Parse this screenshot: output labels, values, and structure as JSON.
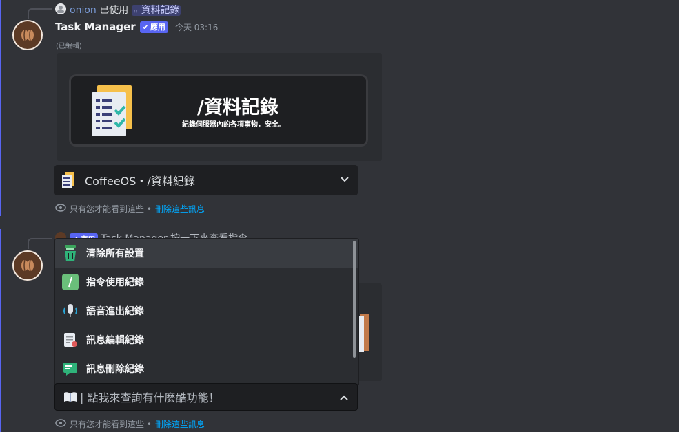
{
  "colors": {
    "background": "#313338",
    "accent": "#5865f2",
    "link": "#00a8fc",
    "dropdown_bg": "#1e1f22"
  },
  "message1": {
    "reply": {
      "user": "onion",
      "used_text": "已使用",
      "command": "資料記錄"
    },
    "author": "Task Manager",
    "app_tag": "應用",
    "timestamp": "今天 03:16",
    "edited": "(已編輯)",
    "banner": {
      "title": "/資料記錄",
      "subtitle": "紀錄伺服器內的各項事物，安全。"
    },
    "select": {
      "value": "CoffeeOS・/資料紀錄",
      "icon": "clipboard-icon"
    },
    "ephemeral": {
      "text": "只有您才能看到這些 •",
      "dismiss": "刪除這些訊息"
    }
  },
  "message2": {
    "reply": {
      "app_tag": "應用",
      "text": "Task Manager 按一下來查看指令"
    },
    "menu": {
      "options": [
        {
          "label": "清除所有設置",
          "icon": "trash-can-icon"
        },
        {
          "label": "指令使用紀錄",
          "icon": "slash-command-icon"
        },
        {
          "label": "語音進出紀錄",
          "icon": "microphone-icon"
        },
        {
          "label": "訊息編輯紀錄",
          "icon": "edit-document-icon"
        },
        {
          "label": "訊息刪除紀錄",
          "icon": "delete-message-icon"
        }
      ]
    },
    "select": {
      "placeholder": "| 點我來查詢有什麼酷功能！",
      "icon": "open-book-icon"
    },
    "ephemeral": {
      "text": "只有您才能看到這些 •",
      "dismiss": "刪除這些訊息"
    }
  }
}
